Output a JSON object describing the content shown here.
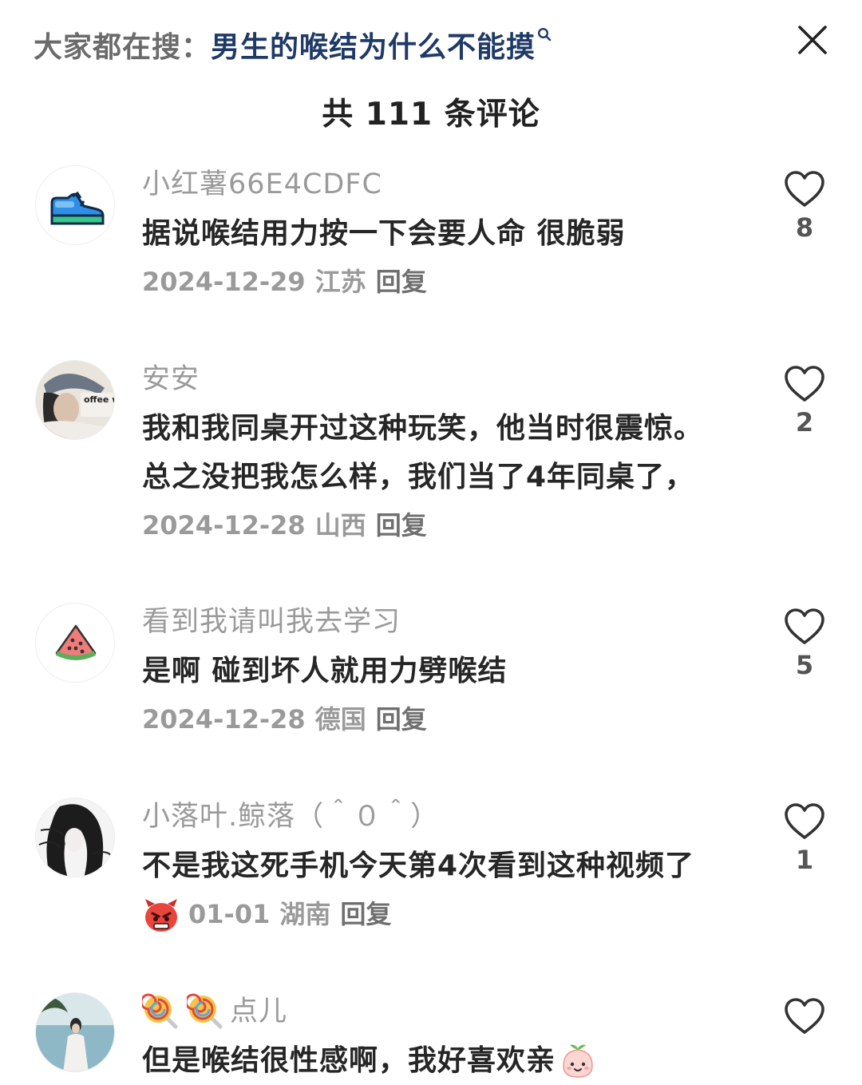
{
  "header": {
    "search_prefix": "大家都在搜：",
    "search_query": "男生的喉结为什么不能摸",
    "comment_count_title": "共 111 条评论"
  },
  "comments": [
    {
      "username": "小红薯66E4CDFC",
      "text_lines": [
        "据说喉结用力按一下会要人命 很脆弱"
      ],
      "date": "2024-12-29",
      "location": "江苏",
      "reply_label": "回复",
      "likes": "8",
      "avatar_icon": "sneaker-icon"
    },
    {
      "username": "安安",
      "text_lines": [
        "我和我同桌开过这种玩笑，他当时很震惊。",
        "总之没把我怎么样，我们当了4年同桌了，"
      ],
      "date": "2024-12-28",
      "location": "山西",
      "reply_label": "回复",
      "likes": "2",
      "avatar_icon": "photo-avatar",
      "avatar_text": "offee wed"
    },
    {
      "username": "看到我请叫我去学习",
      "text_lines": [
        "是啊 碰到坏人就用力劈喉结"
      ],
      "date": "2024-12-28",
      "location": "德国",
      "reply_label": "回复",
      "likes": "5",
      "avatar_icon": "watermelon-icon"
    },
    {
      "username": "小落叶.鲸落（＾０＾）",
      "text_lines": [
        "不是我这死手机今天第4次看到这种视频了"
      ],
      "date": "01-01",
      "location": "湖南",
      "reply_label": "回复",
      "likes": "1",
      "avatar_icon": "anime-avatar",
      "meta_emoji": "angry-face-emoji"
    },
    {
      "username": "点儿",
      "username_emojis": [
        "lollipop-emoji",
        "lollipop-emoji"
      ],
      "text_lines": [
        "但是喉结很性感啊，我好喜欢亲"
      ],
      "text_emoji": "peach-face-emoji",
      "likes": "",
      "avatar_icon": "beach-photo-avatar"
    }
  ],
  "colors": {
    "username": "#9a9a9a",
    "text": "#262626",
    "meta": "#9a9a9a",
    "query": "#1f3a67",
    "prefix": "#6b6b6b"
  }
}
